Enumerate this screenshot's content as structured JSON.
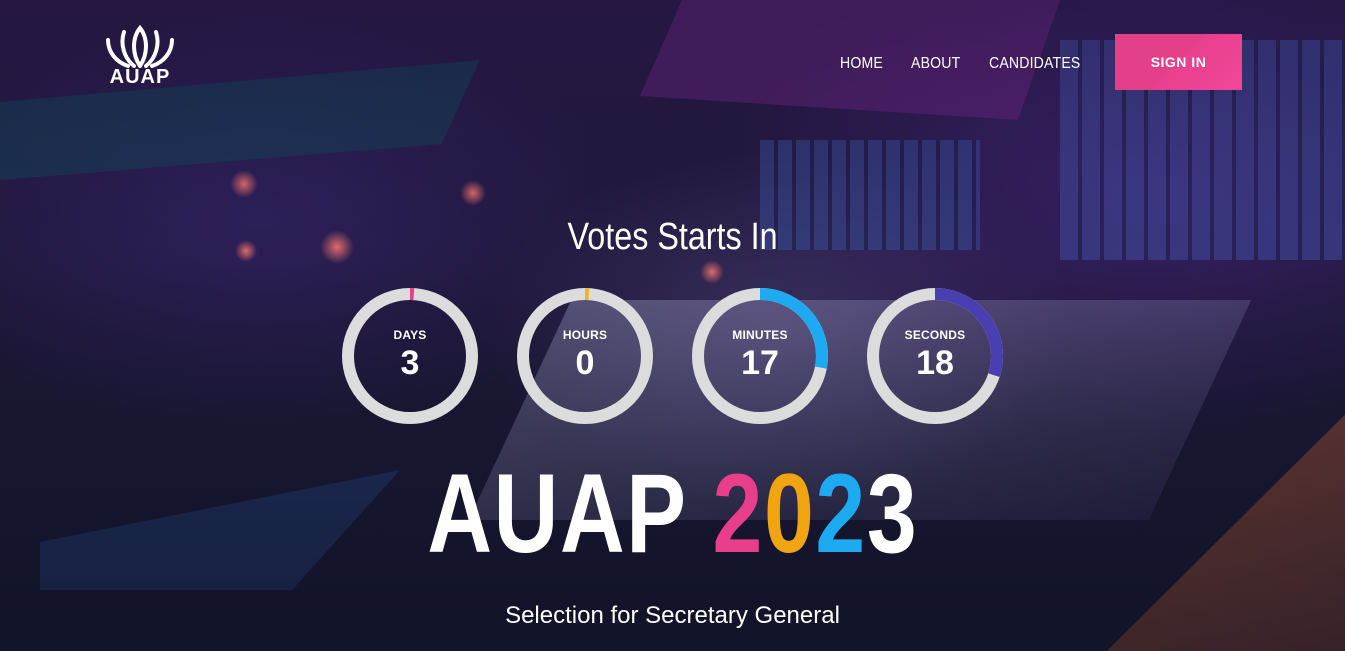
{
  "brand": {
    "logo_text": "AUAP"
  },
  "nav": {
    "items": [
      "HOME",
      "ABOUT",
      "CANDIDATES"
    ],
    "signin_label": "SIGN IN"
  },
  "countdown": {
    "title": "Votes Starts In",
    "units": [
      {
        "label": "DAYS",
        "value": "3",
        "progress": 0.01,
        "color": "#e83e8c"
      },
      {
        "label": "HOURS",
        "value": "0",
        "progress": 0.01,
        "color": "#f0b429"
      },
      {
        "label": "MINUTES",
        "value": "17",
        "progress": 0.28,
        "color": "#1eaaf1"
      },
      {
        "label": "SECONDS",
        "value": "18",
        "progress": 0.3,
        "color": "#4a3fb0"
      }
    ]
  },
  "hero": {
    "title_word": "AUAP",
    "year_digits": [
      {
        "char": "2",
        "color": "#e83e8c"
      },
      {
        "char": "0",
        "color": "#f0a510"
      },
      {
        "char": "2",
        "color": "#1eaaf1"
      },
      {
        "char": "3",
        "color": "#ffffff"
      }
    ],
    "subtitle": "Selection for Secretary General"
  },
  "colors": {
    "accent": "#e83e8c",
    "ring_track": "#dcdcdc"
  }
}
